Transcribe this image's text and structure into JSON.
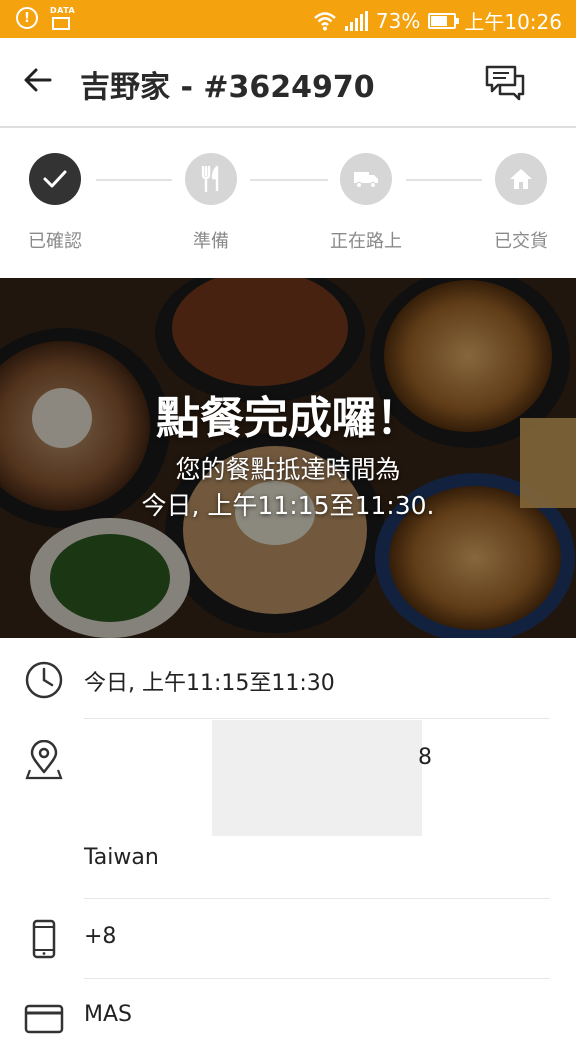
{
  "status_bar": {
    "data_label": "DATA",
    "battery": "73%",
    "battery_level": 0.73,
    "time": "上午10:26",
    "bg_color": "#f5a20f"
  },
  "app_bar": {
    "back_icon": "arrow-left-icon",
    "title": "吉野家 - #3624970",
    "chat_icon": "chat-bubbles-icon"
  },
  "stepper": {
    "steps": [
      {
        "label": "已確認",
        "icon": "check-icon",
        "state": "done"
      },
      {
        "label": "準備",
        "icon": "fork-knife-icon",
        "state": "pending"
      },
      {
        "label": "正在路上",
        "icon": "truck-icon",
        "state": "pending"
      },
      {
        "label": "已交貨",
        "icon": "home-icon",
        "state": "pending"
      }
    ],
    "active_color": "#333333",
    "inactive_color": "#d6d6d6"
  },
  "hero": {
    "title": "點餐完成囉！",
    "line1": "您的餐點抵達時間為",
    "line2": "今日, 上午11:15至11:30."
  },
  "details": {
    "time": "今日, 上午11:15至11:30",
    "address_suffix": "8",
    "address_country": "Taiwan",
    "phone": "+8",
    "payment": "MAS"
  }
}
